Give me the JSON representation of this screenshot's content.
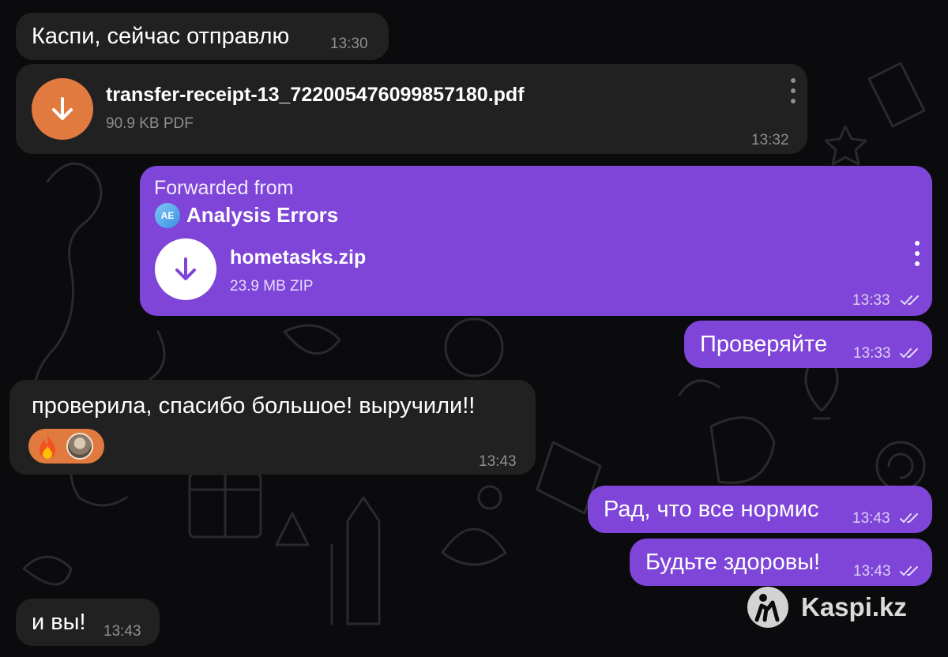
{
  "theme": {
    "background": "#0b0b0d",
    "incoming_bubble": "#212121",
    "outgoing_bubble": "#7e45d8",
    "file_icon_incoming": "#e07a3e",
    "file_icon_outgoing": "#ffffff"
  },
  "messages": [
    {
      "id": "m1",
      "direction": "incoming",
      "text": "Каспи, сейчас отправлю",
      "time": "13:30"
    },
    {
      "id": "m2",
      "direction": "incoming",
      "type": "file",
      "file_name": "transfer-receipt-13_722005476099857180.pdf",
      "file_meta": "90.9 KB PDF",
      "time": "13:32",
      "icon": "download-arrow-icon"
    },
    {
      "id": "m3",
      "direction": "outgoing",
      "type": "forwarded-file",
      "forwarded_label": "Forwarded from",
      "forwarded_initials": "AE",
      "forwarded_source": "Analysis Errors",
      "file_name": "hometasks.zip",
      "file_meta": "23.9 MB ZIP",
      "time": "13:33",
      "status": "read",
      "icon": "download-arrow-icon"
    },
    {
      "id": "m4",
      "direction": "outgoing",
      "text": "Проверяйте",
      "time": "13:33",
      "status": "read"
    },
    {
      "id": "m5",
      "direction": "incoming",
      "text": "проверила, спасибо большое! выручили!!",
      "time": "13:43",
      "reactions": [
        "fire-emoji",
        "user-avatar"
      ]
    },
    {
      "id": "m6",
      "direction": "outgoing",
      "text": "Рад, что все нормис",
      "time": "13:43",
      "status": "read"
    },
    {
      "id": "m7",
      "direction": "outgoing",
      "text": "Будьте здоровы!",
      "time": "13:43",
      "status": "read"
    },
    {
      "id": "m8",
      "direction": "incoming",
      "text": "и вы!",
      "time": "13:43"
    }
  ],
  "watermark": {
    "text": "Kaspi.kz",
    "icon": "kaspi-logo-icon"
  }
}
